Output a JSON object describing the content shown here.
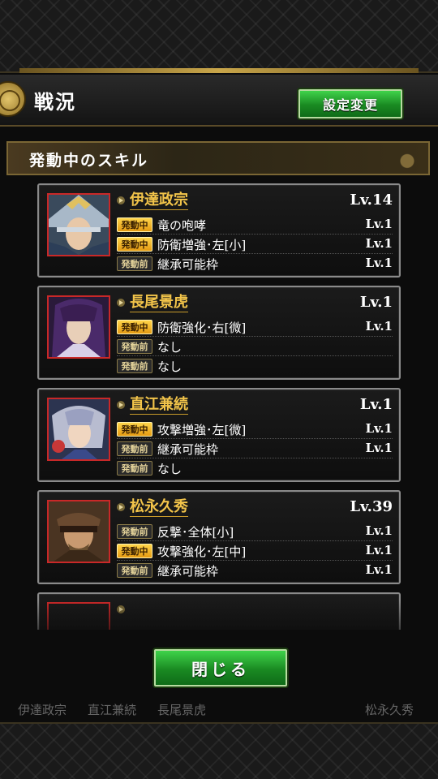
{
  "header": {
    "title": "戦況",
    "settings_label": "設定変更"
  },
  "section": {
    "label": "発動中のスキル"
  },
  "tags": {
    "active": "発動中",
    "inactive": "発動前"
  },
  "cards": [
    {
      "name": "伊達政宗",
      "level": "Lv.14",
      "skills": [
        {
          "status": "発動中",
          "state": "on",
          "name": "竜の咆哮",
          "level": "Lv.1"
        },
        {
          "status": "発動中",
          "state": "on",
          "name": "防衛増強･左[小]",
          "level": "Lv.1"
        },
        {
          "status": "発動前",
          "state": "off",
          "name": "継承可能枠",
          "level": "Lv.1"
        }
      ]
    },
    {
      "name": "長尾景虎",
      "level": "Lv.1",
      "skills": [
        {
          "status": "発動中",
          "state": "on",
          "name": "防衛強化･右[微]",
          "level": "Lv.1"
        },
        {
          "status": "発動前",
          "state": "off",
          "name": "なし",
          "level": ""
        },
        {
          "status": "発動前",
          "state": "off",
          "name": "なし",
          "level": ""
        }
      ]
    },
    {
      "name": "直江兼続",
      "level": "Lv.1",
      "skills": [
        {
          "status": "発動中",
          "state": "on",
          "name": "攻撃増強･左[微]",
          "level": "Lv.1"
        },
        {
          "status": "発動前",
          "state": "off",
          "name": "継承可能枠",
          "level": "Lv.1"
        },
        {
          "status": "発動前",
          "state": "off",
          "name": "なし",
          "level": ""
        }
      ]
    },
    {
      "name": "松永久秀",
      "level": "Lv.39",
      "skills": [
        {
          "status": "発動前",
          "state": "off",
          "name": "反撃･全体[小]",
          "level": "Lv.1"
        },
        {
          "status": "発動中",
          "state": "on",
          "name": "攻撃強化･左[中]",
          "level": "Lv.1"
        },
        {
          "status": "発動前",
          "state": "off",
          "name": "継承可能枠",
          "level": "Lv.1"
        }
      ]
    }
  ],
  "close_label": "閉じる",
  "footer": {
    "names": [
      "伊達政宗",
      "直江兼続",
      "長尾景虎",
      "松永久秀"
    ]
  },
  "colors": {
    "accent_green": "#1a8a22",
    "name_gold": "#f2c44a",
    "tag_active": "#ffd54a",
    "portrait_border": "#c92828"
  }
}
